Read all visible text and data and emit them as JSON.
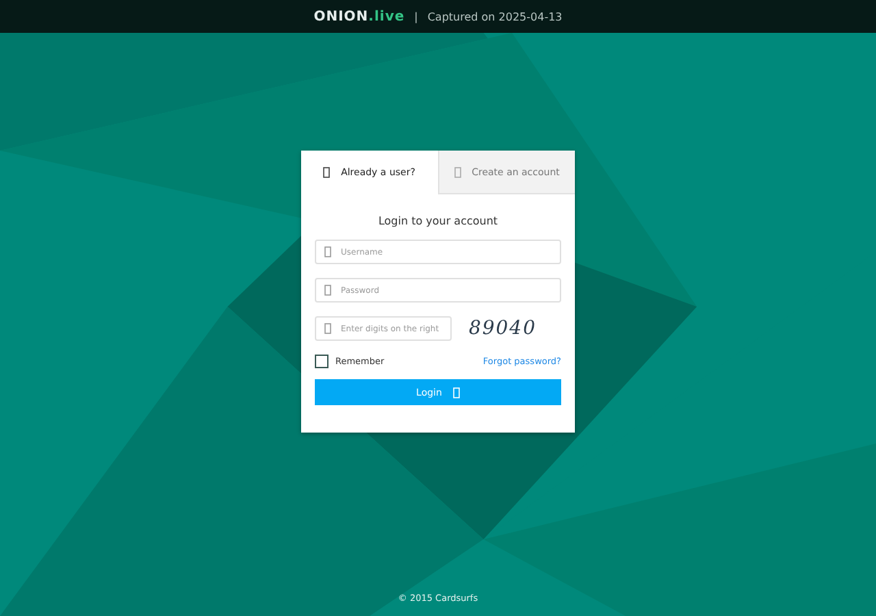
{
  "header": {
    "brand": "ONION",
    "brand_suffix": ".live",
    "separator": "|",
    "captured": "Captured on 2025-04-13"
  },
  "tabs": [
    {
      "label": "Already a user?",
      "selected": true
    },
    {
      "label": "Create an account",
      "selected": false
    }
  ],
  "form": {
    "title": "Login to your account",
    "username": {
      "placeholder": "Username"
    },
    "password": {
      "placeholder": "Password"
    },
    "captcha": {
      "placeholder": "Enter digits on the right",
      "code": "89040"
    },
    "remember": {
      "label": "Remember",
      "checked": false
    },
    "forgot": "Forgot password?",
    "submit": "Login"
  },
  "footer": "© 2015 Cardsurfs"
}
